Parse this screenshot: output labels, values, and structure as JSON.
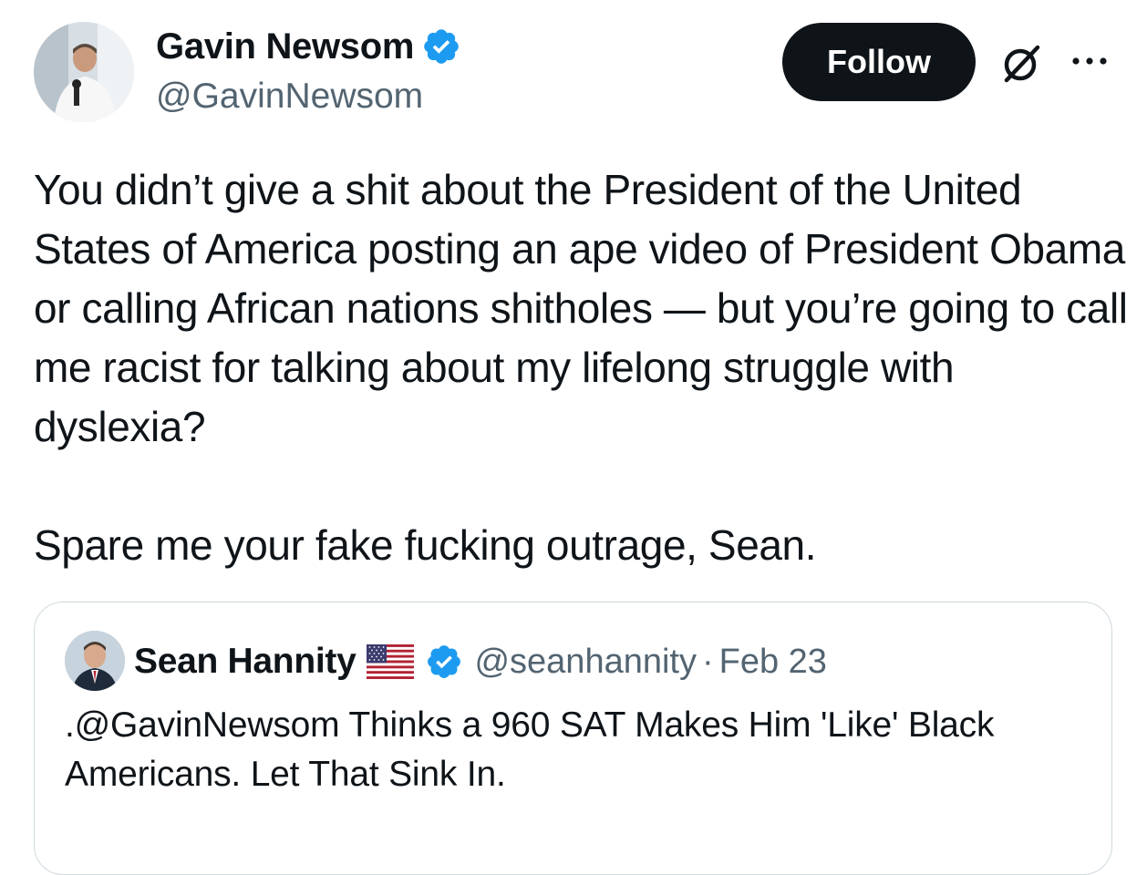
{
  "author": {
    "display_name": "Gavin Newsom",
    "handle": "@GavinNewsom",
    "verified": true,
    "avatar_icon": "person-avatar"
  },
  "actions": {
    "follow_label": "Follow",
    "grok_icon": "grok-icon",
    "more_icon": "more-horizontal-icon"
  },
  "tweet": {
    "text": "You didn’t give a shit about the President of the United States of America posting an ape video of President Obama or calling African nations shitholes — but you’re going  to call me racist for talking about my lifelong struggle with dyslexia?\n\nSpare me your fake fucking outrage, Sean."
  },
  "quoted_tweet": {
    "display_name": "Sean Hannity",
    "flag_icon": "us-flag-icon",
    "verified": true,
    "handle": "@seanhannity",
    "separator": "·",
    "date": "Feb 23",
    "text": ".@GavinNewsom  Thinks a 960 SAT Makes Him 'Like' Black Americans. Let That Sink In."
  },
  "colors": {
    "text_primary": "#0f1419",
    "text_secondary": "#536471",
    "verified_blue": "#1d9bf0",
    "follow_bg": "#0f1419",
    "border": "#cfd9de"
  }
}
